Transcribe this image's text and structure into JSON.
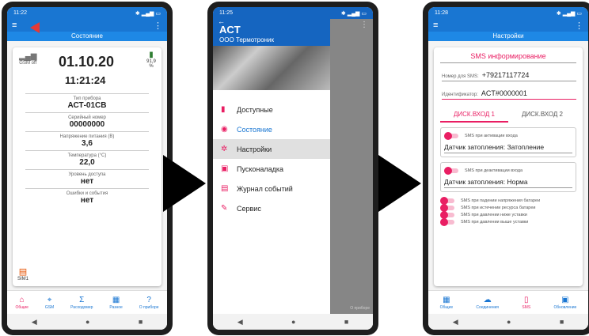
{
  "phone1": {
    "time": "11:22",
    "header": "Состояние",
    "gsm_label": "GSM off",
    "battery_label": "91,9 %",
    "date": "01.10.20",
    "clock": "11:21:24",
    "rows": [
      {
        "label": "Тип прибора",
        "value": "АСТ-01СВ"
      },
      {
        "label": "Серийный номер",
        "value": "00000000"
      },
      {
        "label": "Напряжение питания (В)",
        "value": "3,6"
      },
      {
        "label": "Температура (°С)",
        "value": "22,0"
      },
      {
        "label": "Уровень доступа",
        "value": "нет"
      },
      {
        "label": "Ошибки и события",
        "value": "нет"
      }
    ],
    "sim_label": "SIM1",
    "nav": [
      {
        "icon": "home-icon",
        "label": "Общие"
      },
      {
        "icon": "antenna-icon",
        "label": "GSM"
      },
      {
        "icon": "sigma-icon",
        "label": "Расходомер"
      },
      {
        "icon": "grid-icon",
        "label": "Разное"
      },
      {
        "icon": "help-icon",
        "label": "О приборе"
      }
    ]
  },
  "phone2": {
    "time": "11:25",
    "logo": "ACT",
    "company": "ООО Термотроник",
    "menu": [
      {
        "icon": "bookmark-icon",
        "label": "Доступные"
      },
      {
        "icon": "gauge-icon",
        "label": "Состояние"
      },
      {
        "icon": "settings-icon",
        "label": "Настройки"
      },
      {
        "icon": "tool-icon",
        "label": "Пусконаладка"
      },
      {
        "icon": "journal-icon",
        "label": "Журнал событий"
      },
      {
        "icon": "wrench-icon",
        "label": "Сервис"
      }
    ],
    "nav_tail": "О приборе"
  },
  "phone3": {
    "time": "11:28",
    "header": "Настройки",
    "section_title": "SMS информирование",
    "phone_label": "Номер для SMS:",
    "phone_value": "+79217117724",
    "id_label": "Идентификатор:",
    "id_value": "ACT#0000001",
    "tabs": [
      "ДИСК.ВХОД 1",
      "ДИСК.ВХОД 2"
    ],
    "activation_label": "SMS при активации входа",
    "activation_text": "Датчик затопления: Затопление",
    "deactivation_label": "SMS при деактивации входа",
    "deactivation_text": "Датчик затопления: Норма",
    "toggles": [
      "SMS при падении напряжения батареи",
      "SMS при истечении ресурса батареи",
      "SMS при давлении ниже уставки",
      "SMS при давлении выше уставки"
    ],
    "nav": [
      {
        "icon": "calendar-icon",
        "label": "Общие"
      },
      {
        "icon": "cloud-icon",
        "label": "Соединения"
      },
      {
        "icon": "phone-icon",
        "label": "SMS"
      },
      {
        "icon": "device-icon",
        "label": "Обновление"
      }
    ]
  }
}
